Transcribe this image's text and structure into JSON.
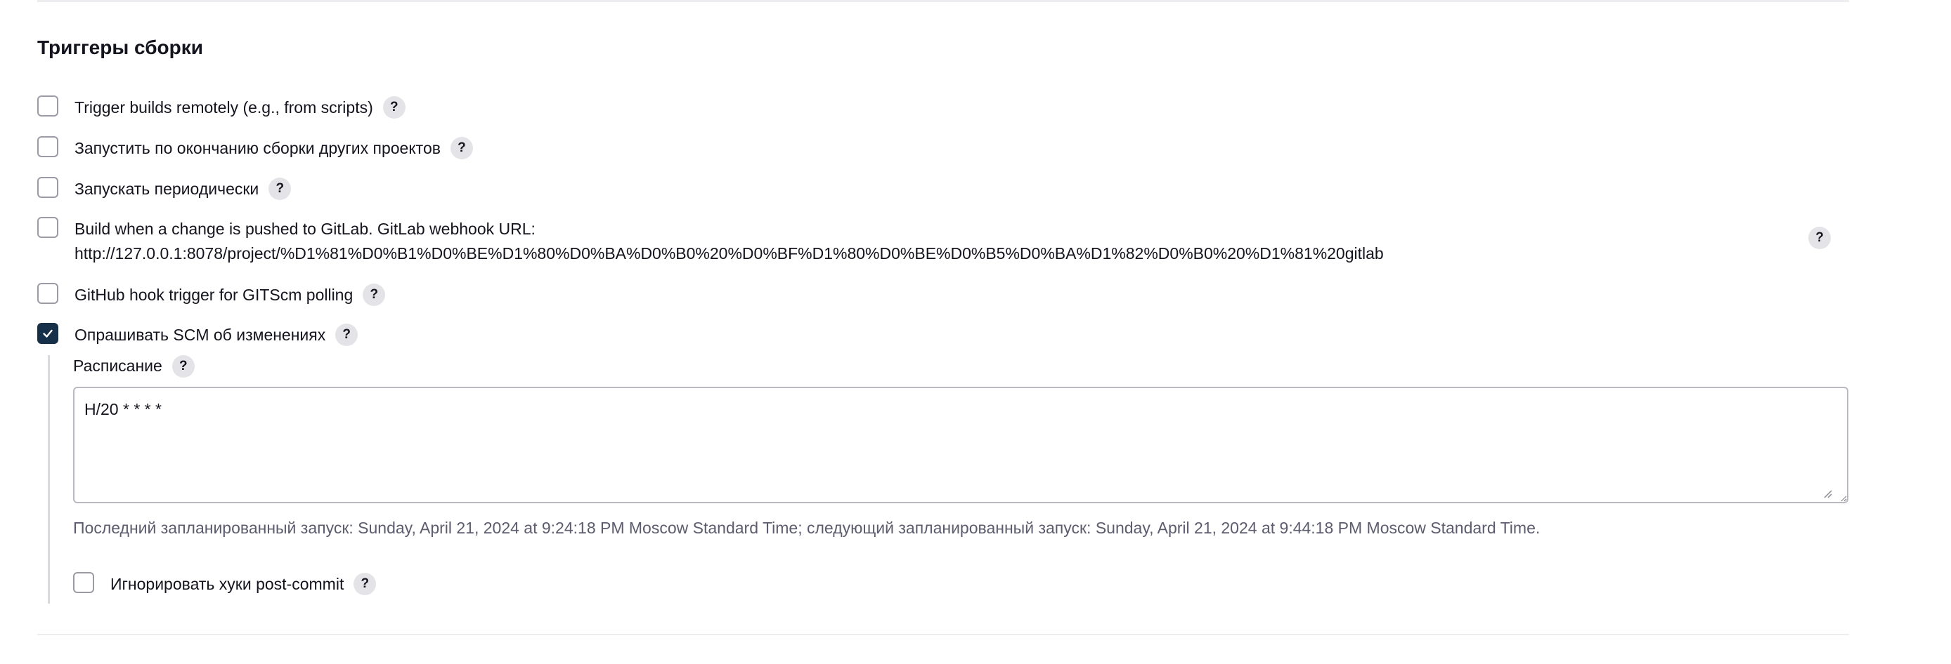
{
  "section": {
    "title": "Триггеры сборки"
  },
  "triggers": [
    {
      "label": "Trigger builds remotely (e.g., from scripts)",
      "checked": false
    },
    {
      "label": "Запустить по окончанию сборки других проектов",
      "checked": false
    },
    {
      "label": "Запускать периодически",
      "checked": false
    },
    {
      "label_line1": "Build when a change is pushed to GitLab. GitLab webhook URL:",
      "label_line2": "http://127.0.0.1:8078/project/%D1%81%D0%B1%D0%BE%D1%80%D0%BA%D0%B0%20%D0%BF%D1%80%D0%BE%D0%B5%D0%BA%D1%82%D0%B0%20%D1%81%20gitlab",
      "checked": false
    },
    {
      "label": "GitHub hook trigger for GITScm polling",
      "checked": false
    },
    {
      "label": "Опрашивать SCM об изменениях",
      "checked": true
    }
  ],
  "scm_polling": {
    "schedule_label": "Расписание",
    "schedule_value": "H/20 * * * *",
    "schedule_info": "Последний запланированный запуск: Sunday, April 21, 2024 at 9:24:18 PM Moscow Standard Time; следующий запланированный запуск: Sunday, April 21, 2024 at 9:44:18 PM Moscow Standard Time.",
    "ignore_hooks_label": "Игнорировать хуки post-commit",
    "ignore_hooks_checked": false
  },
  "help_glyph": "?",
  "icons": {
    "check": "check-icon",
    "help": "help-icon"
  },
  "colors": {
    "checked_fill": "#163049",
    "help_bg": "#e4e4e8",
    "muted_text": "#5c5c6e"
  }
}
